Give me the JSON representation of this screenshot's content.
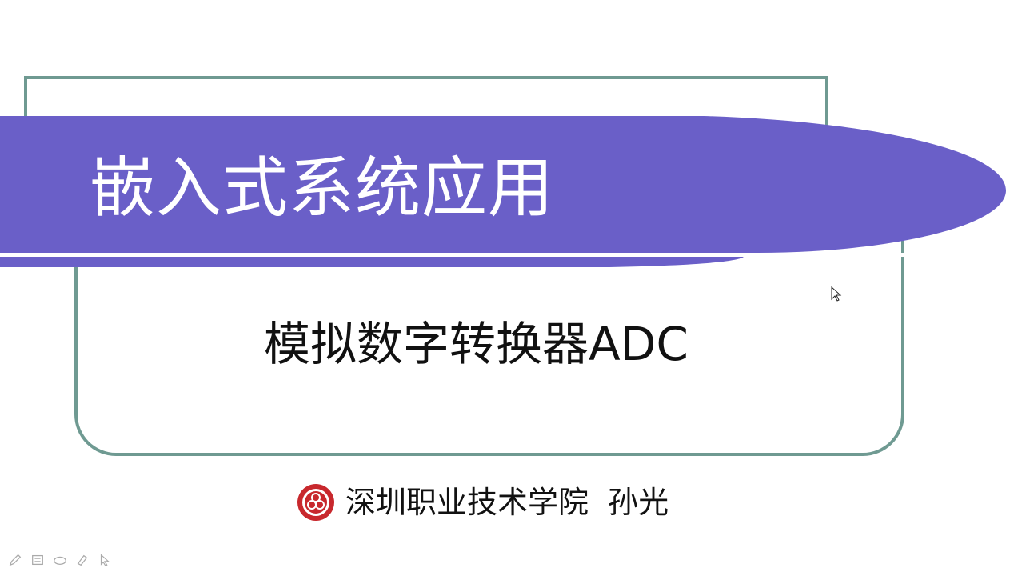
{
  "slide": {
    "title": "嵌入式系统应用",
    "subtitle": "模拟数字转换器ADC",
    "footer": {
      "institution_author": "深圳职业技术学院  孙光"
    }
  },
  "colors": {
    "banner": "#6a5fc8",
    "frame": "#6f9a92",
    "title_text": "#ffffff",
    "body_text": "#111111",
    "logo_red": "#c8282d"
  },
  "toolbar": {
    "tools": [
      "pen-icon",
      "slides-icon",
      "eraser-icon",
      "highlighter-icon",
      "pointer-icon"
    ]
  }
}
